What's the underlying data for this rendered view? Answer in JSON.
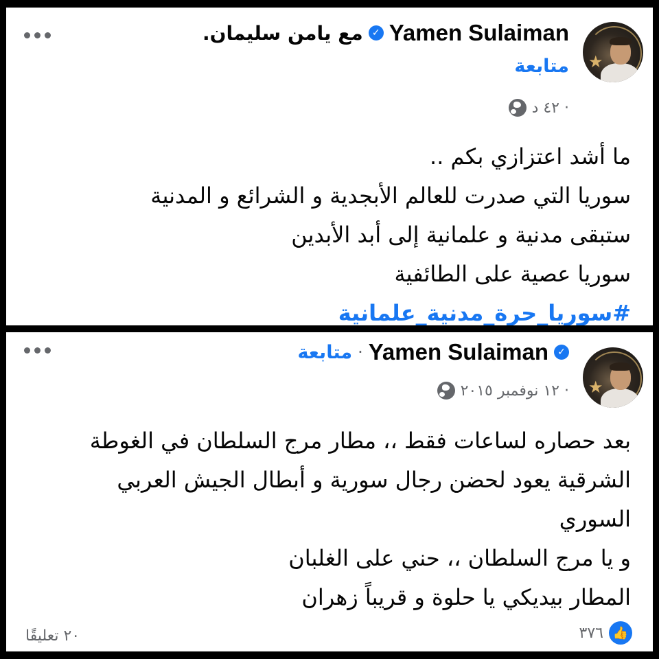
{
  "post1": {
    "author": "Yamen Sulaiman",
    "with_text": "مع يامن سليمان.",
    "follow": "متابعة",
    "time": "٤٢ د ·",
    "lines": [
      "ما أشد اعتزازي بكم ..",
      "سوريا التي صدرت للعالم الأبجدية و الشرائع و المدنية",
      "ستبقى مدنية و علمانية إلى أبد الأبدين",
      "سوريا عصية على الطائفية"
    ],
    "hashtag": "#سوريا_حرة_مدنية_علمانية"
  },
  "post2": {
    "author": "Yamen Sulaiman",
    "follow": "متابعة",
    "separator": "·",
    "time": "١٢ نوفمبر ٢٠١٥ ·",
    "lines": [
      "بعد حصاره لساعات فقط ،، مطار مرج السلطان في الغوطة",
      "الشرقية يعود لحضن رجال سورية و أبطال الجيش العربي",
      "السوري",
      "و يا مرج السلطان ،، حني على الغلبان",
      "المطار بيديكي يا حلوة و قريباً زهران"
    ],
    "likes": "٣٧٦",
    "comments": "٢٠ تعليقًا"
  },
  "icons": {
    "verified": "verified-badge-icon",
    "globe": "globe-icon",
    "more": "more-options-icon",
    "like": "like-thumb-icon"
  },
  "colors": {
    "link_blue": "#1877f2",
    "secondary_gray": "#65676b",
    "frame_black": "#000000"
  }
}
